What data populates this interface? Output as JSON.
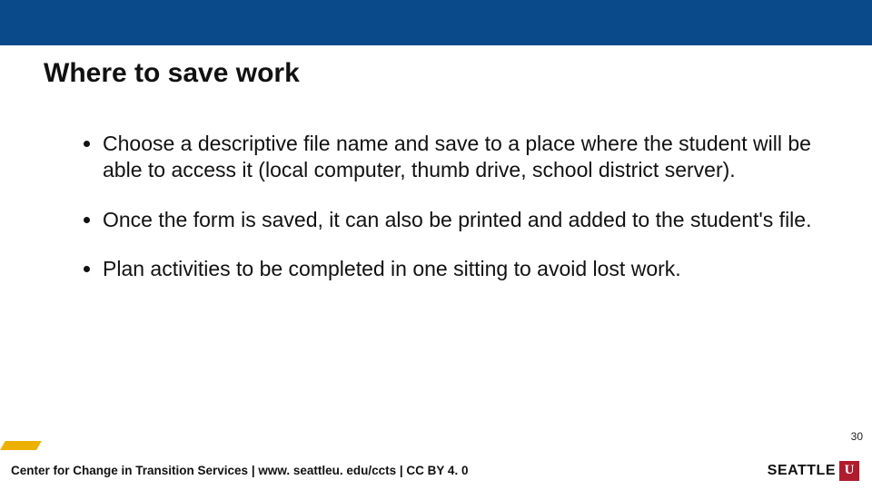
{
  "title": "Where to save work",
  "bullets": [
    "Choose a descriptive file name and save to a place where the student will be able to access it (local computer, thumb drive, school district server).",
    "Once the form is saved, it can also be printed and added to the student's file.",
    "Plan activities to be completed in one sitting to avoid lost work."
  ],
  "page_number": "30",
  "footer_text": "Center for Change in Transition Services | www. seattleu. edu/ccts | CC BY 4. 0",
  "logo_text": "SEATTLE",
  "colors": {
    "top_bar": "#0a4a8a",
    "accent": "#ecb100",
    "logo_red": "#b01c2e"
  }
}
